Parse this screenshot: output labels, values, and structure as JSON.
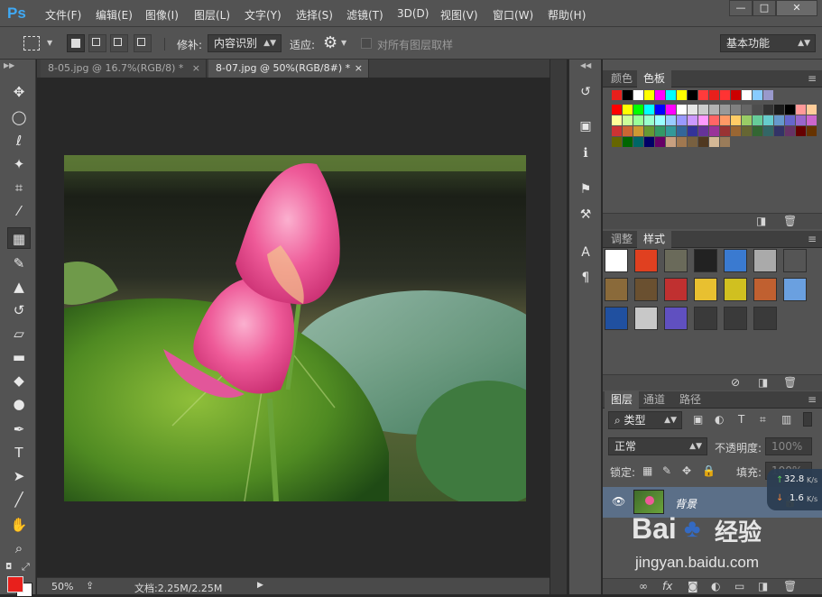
{
  "app": {
    "logo": "Ps"
  },
  "menu": [
    "文件(F)",
    "编辑(E)",
    "图像(I)",
    "图层(L)",
    "文字(Y)",
    "选择(S)",
    "滤镜(T)",
    "3D(D)",
    "视图(V)",
    "窗口(W)",
    "帮助(H)"
  ],
  "window_controls": [
    "—",
    "□",
    "✕"
  ],
  "options": {
    "patch_label": "修补:",
    "patch_value": "内容识别",
    "adapt_label": "适应:",
    "sample_all_label": "对所有图层取样",
    "workspace": "基本功能"
  },
  "tabs": [
    {
      "label": "8-05.jpg @ 16.7%(RGB/8) *",
      "close": "×"
    },
    {
      "label": "8-07.jpg @ 50%(RGB/8#) *",
      "close": "×"
    }
  ],
  "status": {
    "zoom": "50%",
    "doc": "文档:2.25M/2.25M"
  },
  "color_panel": {
    "tabs": [
      "颜色",
      "色板"
    ],
    "active": "色板"
  },
  "adjust_panel": {
    "tabs": [
      "调整",
      "样式"
    ],
    "active": "样式"
  },
  "layers_panel": {
    "tabs": [
      "图层",
      "通道",
      "路径"
    ],
    "active": "图层",
    "filter": "类型",
    "blend_mode": "正常",
    "opacity_label": "不透明度:",
    "opacity_value": "100%",
    "lock_label": "锁定:",
    "fill_label": "填充:",
    "fill_value": "100%",
    "layer_name": "背景"
  },
  "net_speed": {
    "up": "32.8",
    "up_unit": "K/s",
    "down": "1.6",
    "down_unit": "K/s"
  },
  "watermark": {
    "brand_a": "Bai",
    "brand_b": "经验",
    "url": "jingyan.baidu.com"
  },
  "colors": {
    "chrome": "#535353",
    "dark": "#282828",
    "accent": "#3fa9f5",
    "fg_color": "#e8201c"
  }
}
